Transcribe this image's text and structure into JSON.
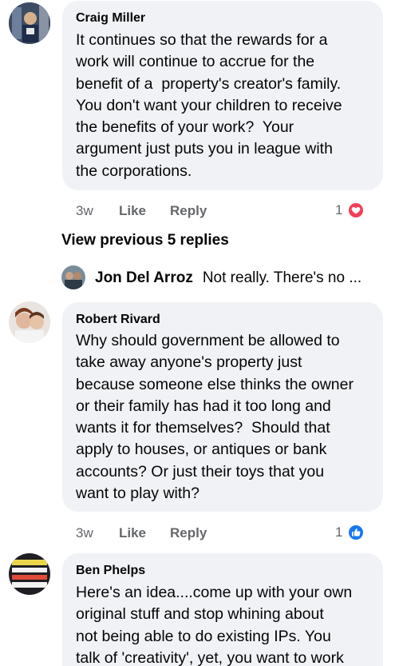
{
  "comments": [
    {
      "author": "Craig Miller",
      "text": "It continues so that the rewards for a\nwork will continue to accrue for the\nbenefit of a  property's creator's family.\nYou don't want your children to receive\nthe benefits of your work?  Your\nargument just puts you in league with\nthe corporations.",
      "time": "3w",
      "like_label": "Like",
      "reply_label": "Reply",
      "reaction_count": "1",
      "reaction_type": "love-icon",
      "reaction_color": "#f33e58"
    },
    {
      "author": "Robert Rivard",
      "text": "Why should government be allowed to\ntake away anyone's property just\nbecause someone else thinks the owner\nor their family has had it too long and\nwants it for themselves?  Should that\napply to houses, or antiques or bank\naccounts? Or just their toys that you\nwant to play with?",
      "time": "3w",
      "like_label": "Like",
      "reply_label": "Reply",
      "reaction_count": "1",
      "reaction_type": "thumbs-up-icon",
      "reaction_color": "#1877f2"
    },
    {
      "author": "Ben Phelps",
      "text": "Here's an idea....come up with your own\noriginal stuff and stop whining about\nnot being able to do existing IPs. You\ntalk of 'creativity', yet, you want to work"
    }
  ],
  "view_previous_replies": "View previous 5 replies",
  "reply_preview": {
    "author": "Jon Del Arroz",
    "text": "Not really. There's no ..."
  }
}
